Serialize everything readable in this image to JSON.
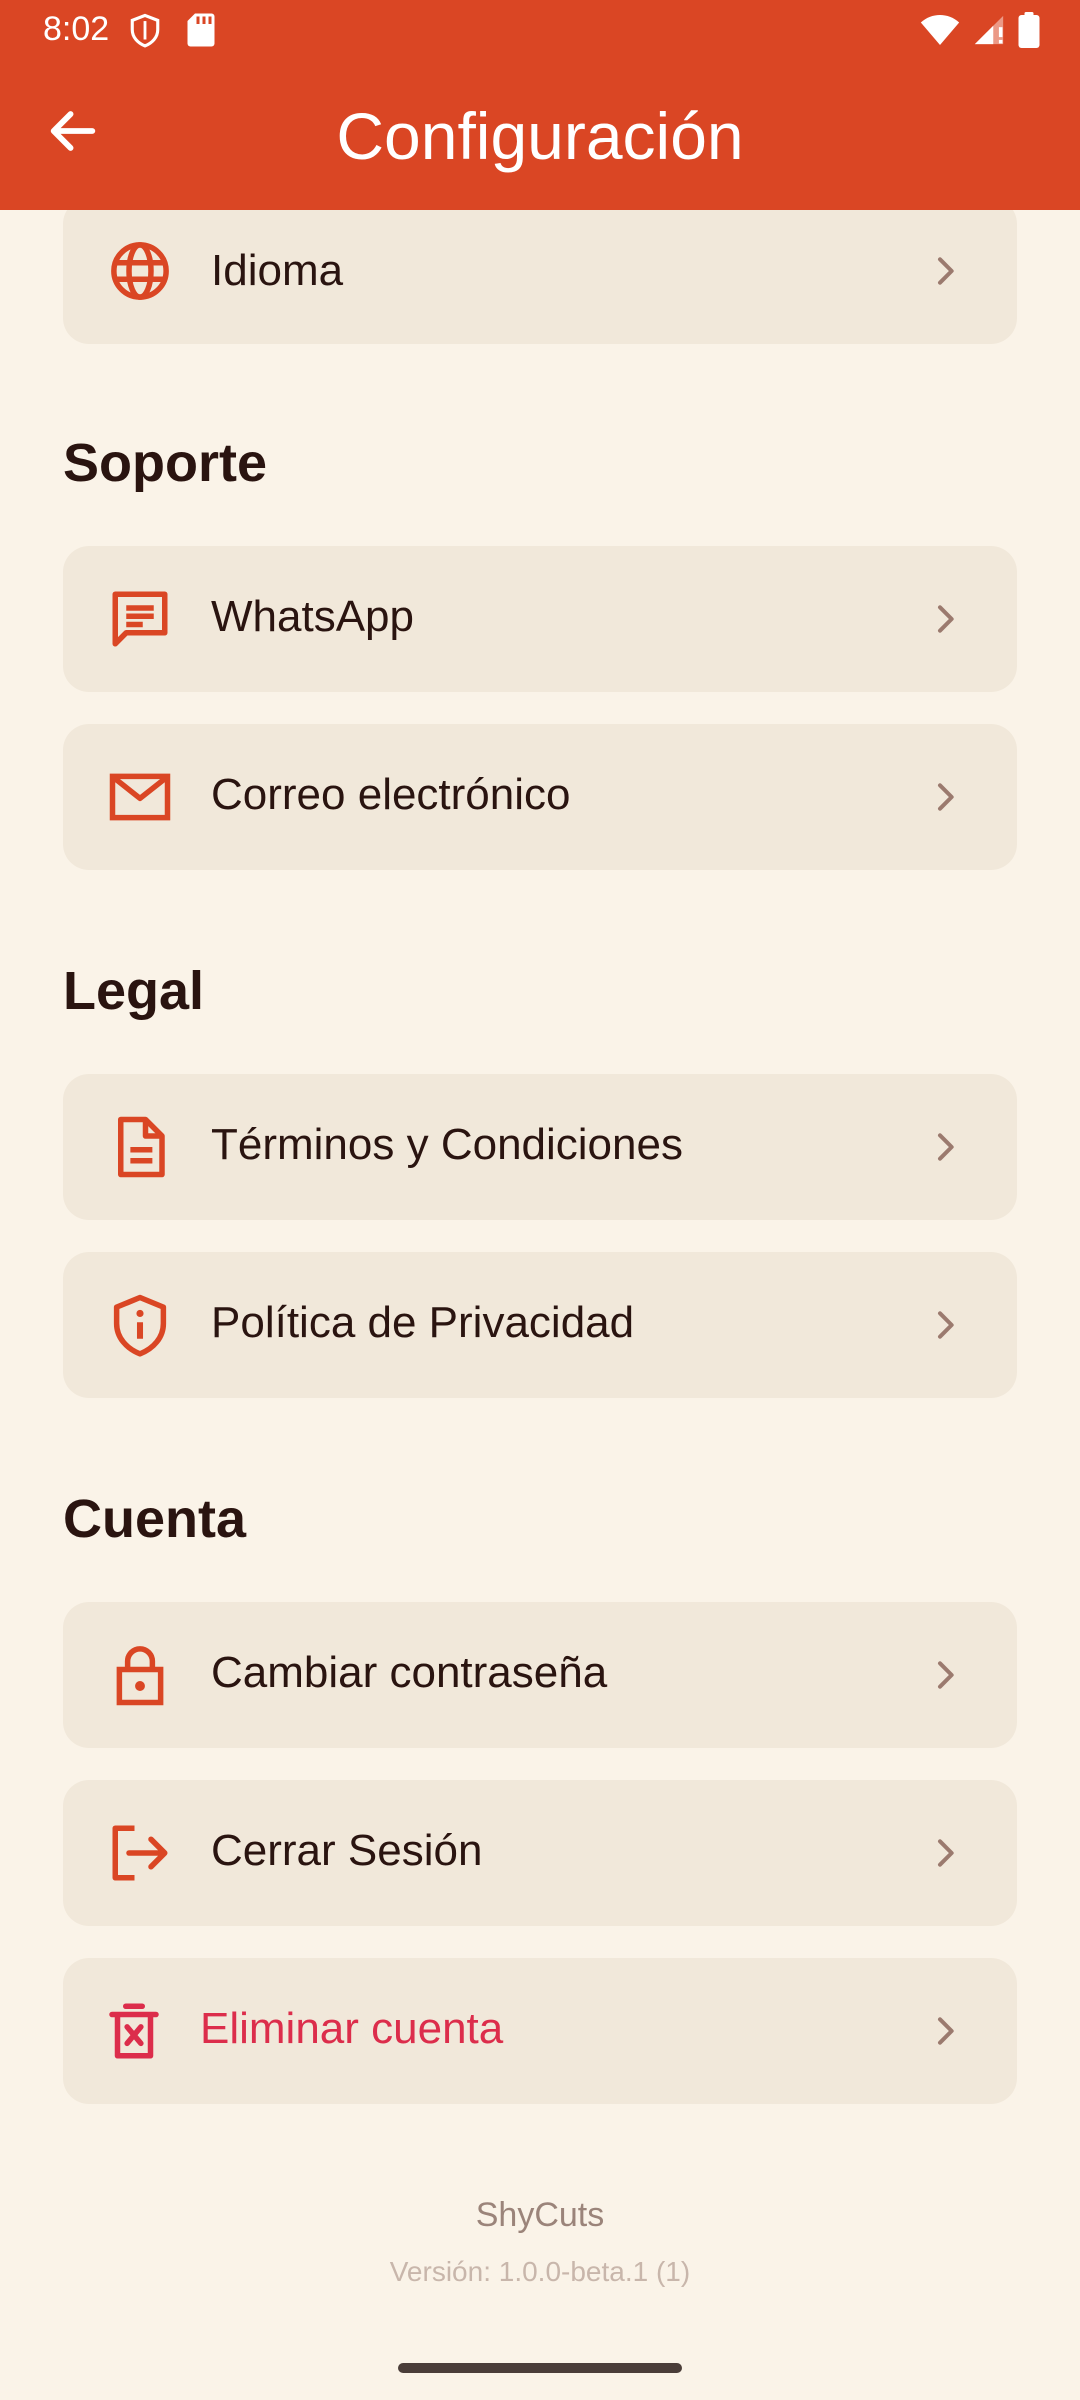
{
  "status_bar": {
    "time": "8:02"
  },
  "app_bar": {
    "title": "Configuración"
  },
  "sections": {
    "soporte": "Soporte",
    "legal": "Legal",
    "cuenta": "Cuenta"
  },
  "items": {
    "idioma": "Idioma",
    "whatsapp": "WhatsApp",
    "correo": "Correo electrónico",
    "terminos": "Términos y Condiciones",
    "privacidad": "Política de Privacidad",
    "cambiar_contrasena": "Cambiar contraseña",
    "cerrar_sesion": "Cerrar Sesión",
    "eliminar_cuenta": "Eliminar cuenta"
  },
  "footer": {
    "app_name": "ShyCuts",
    "version": "Versión: 1.0.0-beta.1 (1)"
  },
  "colors": {
    "primary": "#DA4624",
    "background": "#FAF3E8",
    "card": "#F1E8DA",
    "danger": "#DC2D4B"
  }
}
